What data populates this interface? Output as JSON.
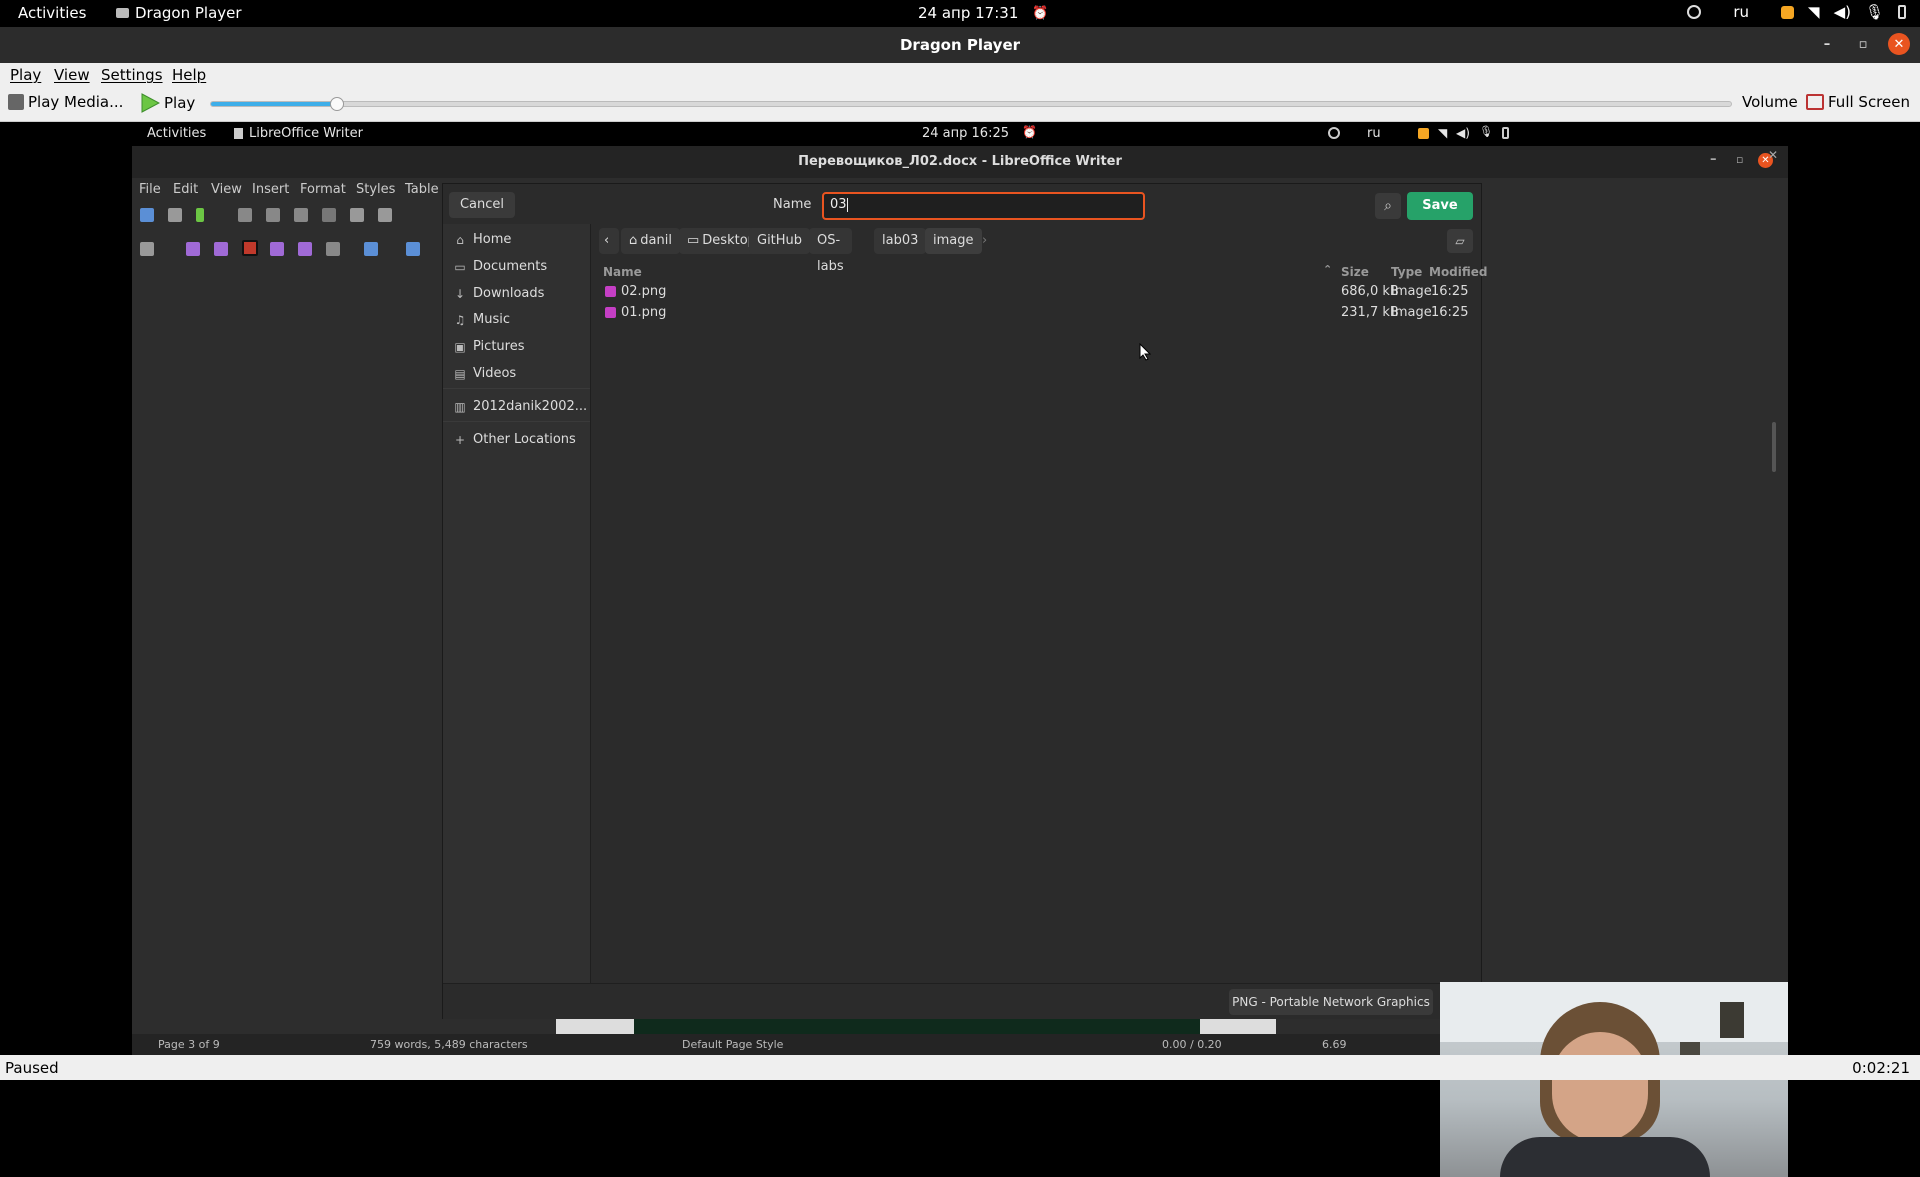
{
  "topbar": {
    "activities": "Activities",
    "app": "Dragon Player",
    "clock": "24 апр  17:31",
    "lang": "ru"
  },
  "window": {
    "title": "Dragon Player"
  },
  "menu": {
    "play": "Play",
    "view": "View",
    "settings": "Settings",
    "help": "Help"
  },
  "toolbar": {
    "play_media": "Play Media...",
    "play": "Play",
    "volume": "Volume",
    "fullscreen": "Full Screen",
    "seek_fraction": 0.083
  },
  "inner": {
    "topbar": {
      "activities": "Activities",
      "app": "LibreOffice Writer",
      "clock": "24 апр  16:25",
      "lang": "ru"
    },
    "title": "Перевощиков_Л02.docx - LibreOffice Writer",
    "writer_menu": [
      "File",
      "Edit",
      "View",
      "Insert",
      "Format",
      "Styles",
      "Table"
    ],
    "dialog": {
      "cancel": "Cancel",
      "name_label": "Name",
      "name_value": "03",
      "save": "Save",
      "sidebar": [
        {
          "icon": "home-icon",
          "label": "Home"
        },
        {
          "icon": "documents-icon",
          "label": "Documents"
        },
        {
          "icon": "downloads-icon",
          "label": "Downloads"
        },
        {
          "icon": "music-icon",
          "label": "Music"
        },
        {
          "icon": "pictures-icon",
          "label": "Pictures"
        },
        {
          "icon": "videos-icon",
          "label": "Videos"
        },
        {
          "icon": "drive-icon",
          "label": "2012danik2002..."
        },
        {
          "icon": "plus-icon",
          "label": "Other Locations"
        }
      ],
      "breadcrumbs": [
        "danil",
        "Desktop",
        "GitHub",
        "OS-labs",
        "lab03",
        "image"
      ],
      "columns": {
        "name": "Name",
        "size": "Size",
        "type": "Type",
        "modified": "Modified"
      },
      "files": [
        {
          "name": "02.png",
          "size": "686,0 kB",
          "type": "Image",
          "modified": "16:25"
        },
        {
          "name": "01.png",
          "size": "231,7 kB",
          "type": "Image",
          "modified": "16:25"
        }
      ],
      "filter": "PNG - Portable Network Graphics"
    },
    "status": {
      "page": "Page 3 of 9",
      "words": "759 words, 5,489 characters",
      "style": "Default Page Style",
      "zoom": "0.00 / 0.20",
      "extra": "6.69"
    }
  },
  "status": {
    "state": "Paused",
    "time": "0:02:21"
  }
}
